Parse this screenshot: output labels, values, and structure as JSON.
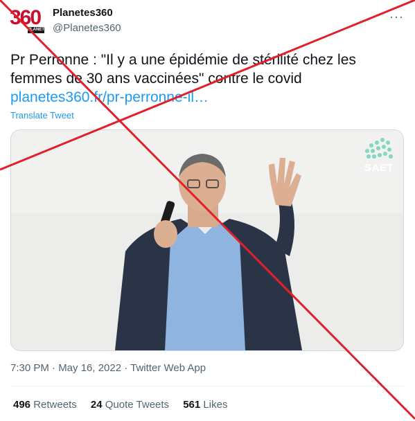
{
  "account": {
    "avatar_number": "360",
    "avatar_label": "PLANETES",
    "name": "Planetes360",
    "handle": "@Planetes360"
  },
  "tweet": {
    "text": "Pr Perronne : \"Il y a une épidémie de stérilité chez les femmes de 30 ans vaccinées\" contre le covid",
    "link": "planetes360.fr/pr-perronne-il…",
    "translate_label": "Translate Tweet",
    "media_watermark": "SAET",
    "timestamp": "7:30 PM · May 16, 2022 · Twitter Web App"
  },
  "stats": [
    {
      "count": "496",
      "label": "Retweets"
    },
    {
      "count": "24",
      "label": "Quote Tweets"
    },
    {
      "count": "561",
      "label": "Likes"
    }
  ],
  "colors": {
    "link": "#1d9bf0",
    "secondary_text": "#536471",
    "cross_overlay": "#e0202a"
  },
  "icons": {
    "more": "more-options-icon"
  }
}
